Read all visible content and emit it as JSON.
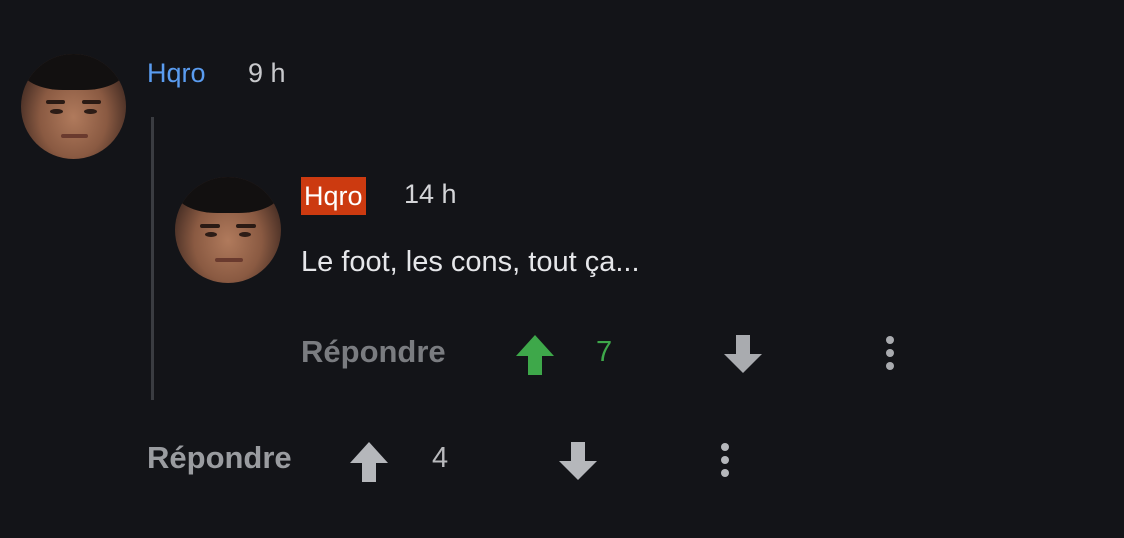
{
  "comment": {
    "author": "Hqro",
    "time": "9 h",
    "actions": {
      "reply_label": "Répondre",
      "upvote_count": "4"
    }
  },
  "reply": {
    "author": "Hqro",
    "time": "14 h",
    "text": "Le foot, les cons, tout ça...",
    "actions": {
      "reply_label": "Répondre",
      "upvote_count": "7"
    }
  },
  "colors": {
    "background": "#131418",
    "author_link": "#5a9cf0",
    "op_badge": "#cc3a10",
    "upvoted": "#3ea84a",
    "muted": "#9a9ca0"
  },
  "icons": {
    "upvote": "arrow-up-icon",
    "downvote": "arrow-down-icon",
    "more": "more-vertical-icon"
  }
}
